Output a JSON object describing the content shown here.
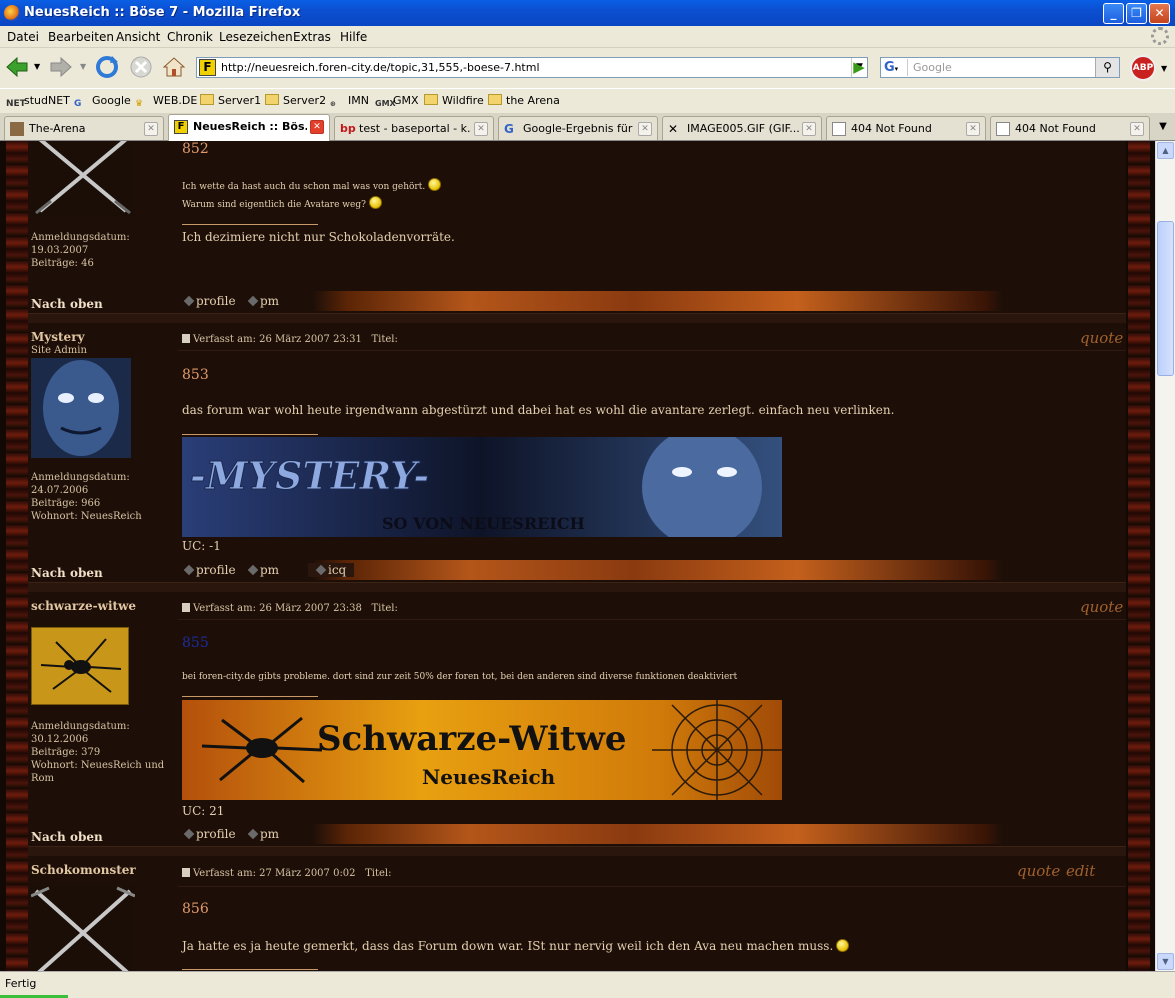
{
  "window": {
    "title": "NeuesReich :: Böse 7 - Mozilla Firefox"
  },
  "menu": [
    "Datei",
    "Bearbeiten",
    "Ansicht",
    "Chronik",
    "Lesezeichen",
    "Extras",
    "Hilfe"
  ],
  "nav": {
    "url": "http://neuesreich.foren-city.de/topic,31,555,-boese-7.html",
    "search_placeholder": "Google"
  },
  "bookmarks": [
    "studNET",
    "Google",
    "WEB.DE",
    "Server1",
    "Server2",
    "IMN",
    "GMX",
    "Wildfire",
    "the Arena"
  ],
  "tabs": [
    {
      "label": "The-Arena",
      "active": false
    },
    {
      "label": "NeuesReich :: Bös...",
      "active": true
    },
    {
      "label": "test - baseportal - k...",
      "active": false
    },
    {
      "label": "Google-Ergebnis für ...",
      "active": false
    },
    {
      "label": "IMAGE005.GIF (GIF...",
      "active": false
    },
    {
      "label": "404 Not Found",
      "active": false
    },
    {
      "label": "404 Not Found",
      "active": false
    }
  ],
  "labels": {
    "nach_oben": "Nach oben",
    "profile": "profile",
    "pm": "pm",
    "icq": "icq",
    "quote": "quote",
    "edit": "edit",
    "titel": "Titel:"
  },
  "posts": [
    {
      "reg": "Anmeldungsdatum:",
      "reg_date": "19.03.2007",
      "beitraege": "Beiträge: 46",
      "number": "852",
      "line1": "Ich wette da hast auch du schon mal was von gehört.",
      "line2": "Warum sind eigentlich die Avatare weg?",
      "signature": "Ich dezimiere nicht nur Schokoladenvorräte."
    },
    {
      "user": "Mystery",
      "rank": "Site Admin",
      "reg": "Anmeldungsdatum:",
      "reg_date": "24.07.2006",
      "beitraege": "Beiträge: 966",
      "wohnort": "Wohnort: NeuesReich",
      "meta": "Verfasst am: 26 März 2007 23:31",
      "number": "853",
      "text": "das forum war wohl heute irgendwann abgestürzt und dabei hat es wohl die avantare zerlegt. einfach neu verlinken.",
      "banner_title": "-MYSTERY-",
      "banner_sub": "SO VON NEUESREICH",
      "uc": "UC: -1"
    },
    {
      "user": "schwarze-witwe",
      "reg": "Anmeldungsdatum:",
      "reg_date": "30.12.2006",
      "beitraege": "Beiträge: 379",
      "wohnort": "Wohnort: NeuesReich und Rom",
      "meta": "Verfasst am: 26 März 2007 23:38",
      "number": "855",
      "text": "bei foren-city.de gibts probleme. dort sind zur zeit 50% der foren tot, bei den anderen sind diverse funktionen deaktiviert",
      "banner_title": "Schwarze-Witwe",
      "banner_sub": "NeuesReich",
      "uc": "UC: 21"
    },
    {
      "user": "Schokomonster",
      "meta": "Verfasst am: 27 März 2007 0:02",
      "number": "856",
      "text": "Ja hatte es ja heute gemerkt, dass das Forum down war. ISt nur nervig weil ich den Ava neu machen muss."
    }
  ],
  "status": {
    "text": "Fertig"
  }
}
